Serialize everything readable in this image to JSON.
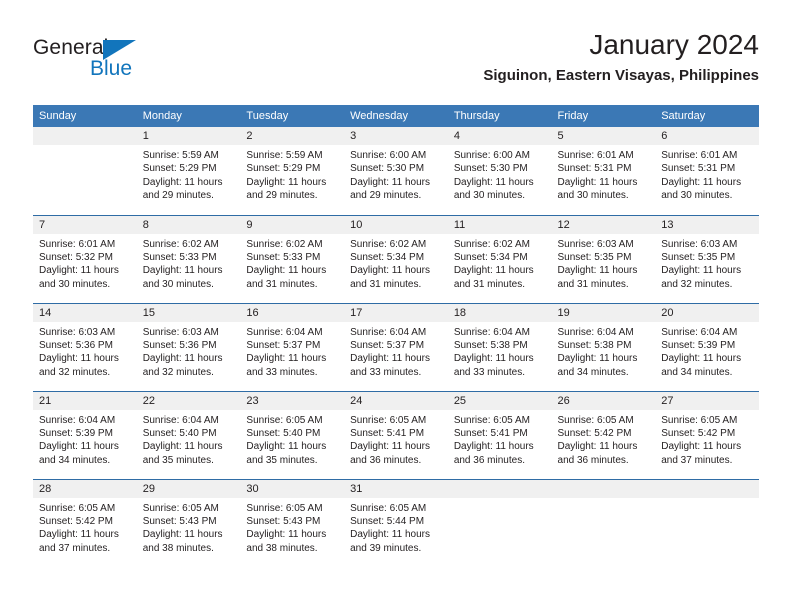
{
  "brand": {
    "name_dark": "General",
    "name_blue": "Blue",
    "accent_color": "#1275bc"
  },
  "header": {
    "title": "January 2024",
    "subtitle": "Siguinon, Eastern Visayas, Philippines"
  },
  "theme": {
    "header_blue": "#3b78b5",
    "row_rule": "#2f6ca5",
    "daynum_band": "#f0f0f0",
    "text": "#231f20"
  },
  "calendar": {
    "weekday_headers": [
      "Sunday",
      "Monday",
      "Tuesday",
      "Wednesday",
      "Thursday",
      "Friday",
      "Saturday"
    ],
    "weeks": [
      [
        {
          "day": "",
          "sunrise": "",
          "sunset": "",
          "daylight1": "",
          "daylight2": ""
        },
        {
          "day": "1",
          "sunrise": "Sunrise: 5:59 AM",
          "sunset": "Sunset: 5:29 PM",
          "daylight1": "Daylight: 11 hours",
          "daylight2": "and 29 minutes."
        },
        {
          "day": "2",
          "sunrise": "Sunrise: 5:59 AM",
          "sunset": "Sunset: 5:29 PM",
          "daylight1": "Daylight: 11 hours",
          "daylight2": "and 29 minutes."
        },
        {
          "day": "3",
          "sunrise": "Sunrise: 6:00 AM",
          "sunset": "Sunset: 5:30 PM",
          "daylight1": "Daylight: 11 hours",
          "daylight2": "and 29 minutes."
        },
        {
          "day": "4",
          "sunrise": "Sunrise: 6:00 AM",
          "sunset": "Sunset: 5:30 PM",
          "daylight1": "Daylight: 11 hours",
          "daylight2": "and 30 minutes."
        },
        {
          "day": "5",
          "sunrise": "Sunrise: 6:01 AM",
          "sunset": "Sunset: 5:31 PM",
          "daylight1": "Daylight: 11 hours",
          "daylight2": "and 30 minutes."
        },
        {
          "day": "6",
          "sunrise": "Sunrise: 6:01 AM",
          "sunset": "Sunset: 5:31 PM",
          "daylight1": "Daylight: 11 hours",
          "daylight2": "and 30 minutes."
        }
      ],
      [
        {
          "day": "7",
          "sunrise": "Sunrise: 6:01 AM",
          "sunset": "Sunset: 5:32 PM",
          "daylight1": "Daylight: 11 hours",
          "daylight2": "and 30 minutes."
        },
        {
          "day": "8",
          "sunrise": "Sunrise: 6:02 AM",
          "sunset": "Sunset: 5:33 PM",
          "daylight1": "Daylight: 11 hours",
          "daylight2": "and 30 minutes."
        },
        {
          "day": "9",
          "sunrise": "Sunrise: 6:02 AM",
          "sunset": "Sunset: 5:33 PM",
          "daylight1": "Daylight: 11 hours",
          "daylight2": "and 31 minutes."
        },
        {
          "day": "10",
          "sunrise": "Sunrise: 6:02 AM",
          "sunset": "Sunset: 5:34 PM",
          "daylight1": "Daylight: 11 hours",
          "daylight2": "and 31 minutes."
        },
        {
          "day": "11",
          "sunrise": "Sunrise: 6:02 AM",
          "sunset": "Sunset: 5:34 PM",
          "daylight1": "Daylight: 11 hours",
          "daylight2": "and 31 minutes."
        },
        {
          "day": "12",
          "sunrise": "Sunrise: 6:03 AM",
          "sunset": "Sunset: 5:35 PM",
          "daylight1": "Daylight: 11 hours",
          "daylight2": "and 31 minutes."
        },
        {
          "day": "13",
          "sunrise": "Sunrise: 6:03 AM",
          "sunset": "Sunset: 5:35 PM",
          "daylight1": "Daylight: 11 hours",
          "daylight2": "and 32 minutes."
        }
      ],
      [
        {
          "day": "14",
          "sunrise": "Sunrise: 6:03 AM",
          "sunset": "Sunset: 5:36 PM",
          "daylight1": "Daylight: 11 hours",
          "daylight2": "and 32 minutes."
        },
        {
          "day": "15",
          "sunrise": "Sunrise: 6:03 AM",
          "sunset": "Sunset: 5:36 PM",
          "daylight1": "Daylight: 11 hours",
          "daylight2": "and 32 minutes."
        },
        {
          "day": "16",
          "sunrise": "Sunrise: 6:04 AM",
          "sunset": "Sunset: 5:37 PM",
          "daylight1": "Daylight: 11 hours",
          "daylight2": "and 33 minutes."
        },
        {
          "day": "17",
          "sunrise": "Sunrise: 6:04 AM",
          "sunset": "Sunset: 5:37 PM",
          "daylight1": "Daylight: 11 hours",
          "daylight2": "and 33 minutes."
        },
        {
          "day": "18",
          "sunrise": "Sunrise: 6:04 AM",
          "sunset": "Sunset: 5:38 PM",
          "daylight1": "Daylight: 11 hours",
          "daylight2": "and 33 minutes."
        },
        {
          "day": "19",
          "sunrise": "Sunrise: 6:04 AM",
          "sunset": "Sunset: 5:38 PM",
          "daylight1": "Daylight: 11 hours",
          "daylight2": "and 34 minutes."
        },
        {
          "day": "20",
          "sunrise": "Sunrise: 6:04 AM",
          "sunset": "Sunset: 5:39 PM",
          "daylight1": "Daylight: 11 hours",
          "daylight2": "and 34 minutes."
        }
      ],
      [
        {
          "day": "21",
          "sunrise": "Sunrise: 6:04 AM",
          "sunset": "Sunset: 5:39 PM",
          "daylight1": "Daylight: 11 hours",
          "daylight2": "and 34 minutes."
        },
        {
          "day": "22",
          "sunrise": "Sunrise: 6:04 AM",
          "sunset": "Sunset: 5:40 PM",
          "daylight1": "Daylight: 11 hours",
          "daylight2": "and 35 minutes."
        },
        {
          "day": "23",
          "sunrise": "Sunrise: 6:05 AM",
          "sunset": "Sunset: 5:40 PM",
          "daylight1": "Daylight: 11 hours",
          "daylight2": "and 35 minutes."
        },
        {
          "day": "24",
          "sunrise": "Sunrise: 6:05 AM",
          "sunset": "Sunset: 5:41 PM",
          "daylight1": "Daylight: 11 hours",
          "daylight2": "and 36 minutes."
        },
        {
          "day": "25",
          "sunrise": "Sunrise: 6:05 AM",
          "sunset": "Sunset: 5:41 PM",
          "daylight1": "Daylight: 11 hours",
          "daylight2": "and 36 minutes."
        },
        {
          "day": "26",
          "sunrise": "Sunrise: 6:05 AM",
          "sunset": "Sunset: 5:42 PM",
          "daylight1": "Daylight: 11 hours",
          "daylight2": "and 36 minutes."
        },
        {
          "day": "27",
          "sunrise": "Sunrise: 6:05 AM",
          "sunset": "Sunset: 5:42 PM",
          "daylight1": "Daylight: 11 hours",
          "daylight2": "and 37 minutes."
        }
      ],
      [
        {
          "day": "28",
          "sunrise": "Sunrise: 6:05 AM",
          "sunset": "Sunset: 5:42 PM",
          "daylight1": "Daylight: 11 hours",
          "daylight2": "and 37 minutes."
        },
        {
          "day": "29",
          "sunrise": "Sunrise: 6:05 AM",
          "sunset": "Sunset: 5:43 PM",
          "daylight1": "Daylight: 11 hours",
          "daylight2": "and 38 minutes."
        },
        {
          "day": "30",
          "sunrise": "Sunrise: 6:05 AM",
          "sunset": "Sunset: 5:43 PM",
          "daylight1": "Daylight: 11 hours",
          "daylight2": "and 38 minutes."
        },
        {
          "day": "31",
          "sunrise": "Sunrise: 6:05 AM",
          "sunset": "Sunset: 5:44 PM",
          "daylight1": "Daylight: 11 hours",
          "daylight2": "and 39 minutes."
        },
        {
          "day": "",
          "sunrise": "",
          "sunset": "",
          "daylight1": "",
          "daylight2": ""
        },
        {
          "day": "",
          "sunrise": "",
          "sunset": "",
          "daylight1": "",
          "daylight2": ""
        },
        {
          "day": "",
          "sunrise": "",
          "sunset": "",
          "daylight1": "",
          "daylight2": ""
        }
      ]
    ]
  }
}
